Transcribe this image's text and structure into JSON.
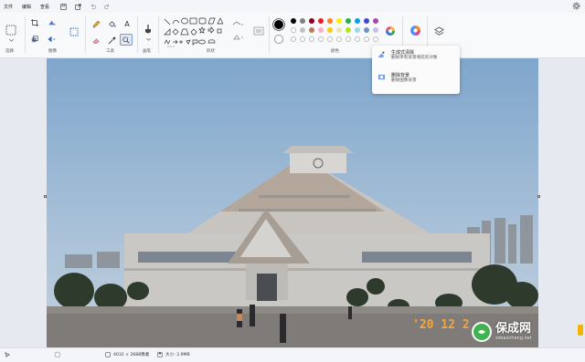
{
  "menu": {
    "file": "文件",
    "edit": "编辑",
    "view": "查看"
  },
  "ribbon": {
    "groups": {
      "select": "选择",
      "image": "图像",
      "tools": "工具",
      "brushes": "画笔",
      "shapes": "形状",
      "colors": "颜色"
    },
    "text_tool": "A"
  },
  "colors": {
    "row1": [
      "#000000",
      "#7f7f7f",
      "#880015",
      "#ed1c24",
      "#ff7f27",
      "#fff200",
      "#22b14c",
      "#00a2e8",
      "#3f48cc",
      "#a349a4"
    ],
    "row2": [
      "#ffffff",
      "#c3c3c3",
      "#b97a57",
      "#ffaec9",
      "#ffc90e",
      "#efe4b0",
      "#b5e61d",
      "#99d9ea",
      "#7092be",
      "#c8bfe7"
    ],
    "primary": "#000000",
    "secondary": "#ffffff",
    "accent": "#0067c0"
  },
  "popup": {
    "generative_erase": {
      "title": "生成式清除",
      "desc": "删除带有背景填充的对象"
    },
    "remove_background": {
      "title": "删除背景",
      "desc": "删除图像背景"
    }
  },
  "photo": {
    "date_stamp": "'20 12 2"
  },
  "status": {
    "dimensions": "4032 × 2688像素",
    "size": "大小: 2.9MB"
  },
  "watermark": {
    "brand": "保成网",
    "url": "zsbaocheng.net"
  }
}
